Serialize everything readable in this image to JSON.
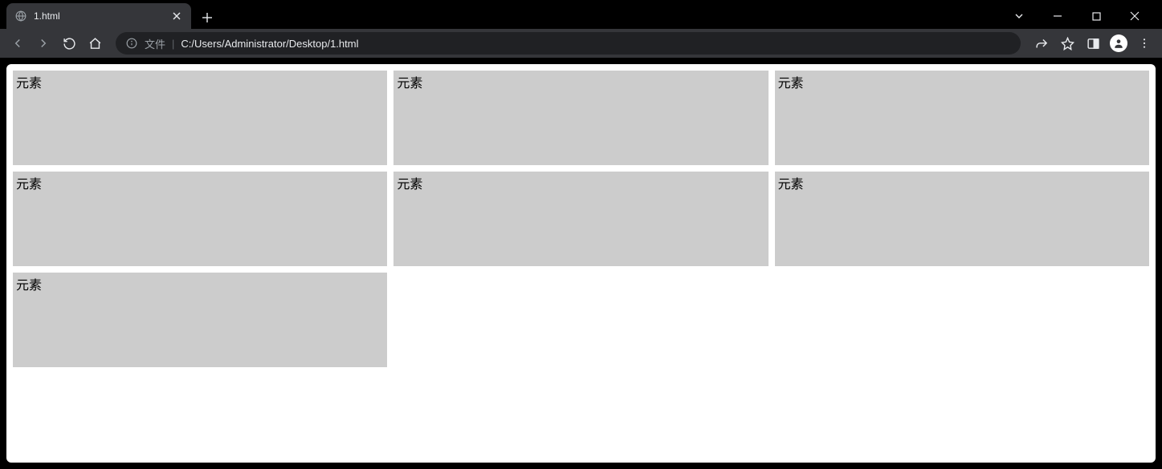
{
  "browser": {
    "tab_title": "1.html",
    "url_scheme_label": "文件",
    "url": "C:/Users/Administrator/Desktop/1.html"
  },
  "page": {
    "items": [
      {
        "label": "元素"
      },
      {
        "label": "元素"
      },
      {
        "label": "元素"
      },
      {
        "label": "元素"
      },
      {
        "label": "元素"
      },
      {
        "label": "元素"
      },
      {
        "label": "元素"
      }
    ]
  }
}
